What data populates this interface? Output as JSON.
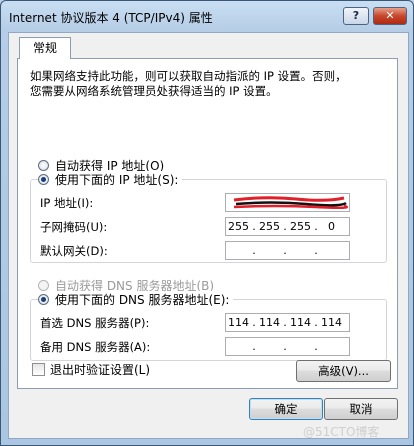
{
  "window": {
    "title": "Internet 协议版本 4 (TCP/IPv4) 属性",
    "help_glyph": "?",
    "close_glyph": "✕"
  },
  "tab": {
    "label": "常规"
  },
  "intro": {
    "line1": "如果网络支持此功能，则可以获取自动指派的 IP 设置。否则，",
    "line2": "您需要从网络系统管理员处获得适当的 IP 设置。"
  },
  "ip": {
    "auto_label": "自动获得 IP 地址(O)",
    "manual_label": "使用下面的 IP 地址(S):",
    "address_label": "IP 地址(I):",
    "address_value": [
      "",
      "",
      "",
      ""
    ],
    "subnet_label": "子网掩码(U):",
    "subnet_value": [
      "255",
      "255",
      "255",
      "0"
    ],
    "gateway_label": "默认网关(D):",
    "gateway_value": [
      "",
      "",
      "",
      ""
    ],
    "selected": "manual"
  },
  "dns": {
    "auto_label": "自动获得 DNS 服务器地址(B)",
    "manual_label": "使用下面的 DNS 服务器地址(E):",
    "preferred_label": "首选 DNS 服务器(P):",
    "preferred_value": [
      "114",
      "114",
      "114",
      "114"
    ],
    "alternate_label": "备用 DNS 服务器(A):",
    "alternate_value": [
      "",
      "",
      "",
      ""
    ],
    "selected": "manual"
  },
  "validate": {
    "label": "退出时验证设置(L)",
    "checked": false
  },
  "buttons": {
    "advanced": "高级(V)...",
    "ok": "确定",
    "cancel": "取消"
  },
  "watermark": "@51CTO博客"
}
